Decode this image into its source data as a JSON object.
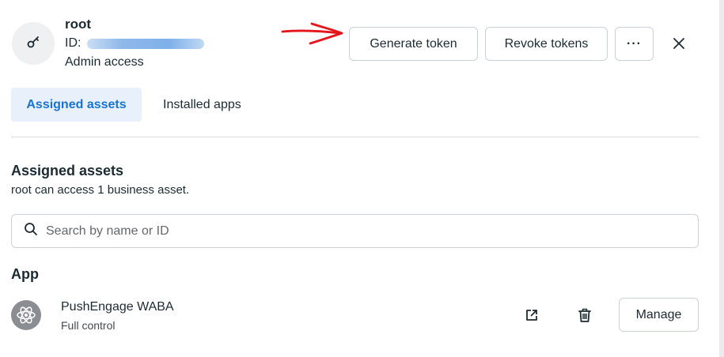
{
  "user": {
    "name": "root",
    "id_label": "ID:",
    "access": "Admin access",
    "avatar_icon": "key-icon"
  },
  "annotation": {
    "arrow_color": "#e4161b"
  },
  "header_actions": {
    "generate_label": "Generate token",
    "revoke_label": "Revoke tokens",
    "more_label": "···",
    "close_icon": "close-icon"
  },
  "tabs": [
    {
      "label": "Assigned assets",
      "active": true
    },
    {
      "label": "Installed apps",
      "active": false
    }
  ],
  "assigned": {
    "title": "Assigned assets",
    "description": "root can access 1 business asset."
  },
  "search": {
    "placeholder": "Search by name or ID",
    "value": ""
  },
  "app_section": {
    "title": "App",
    "items": [
      {
        "name": "PushEngage WABA",
        "permission": "Full control",
        "manage_label": "Manage"
      }
    ]
  },
  "colors": {
    "accent": "#1a73d1",
    "accent_bg": "#e7f0fb",
    "text": "#1c2b33",
    "border": "#cbd2d9"
  }
}
